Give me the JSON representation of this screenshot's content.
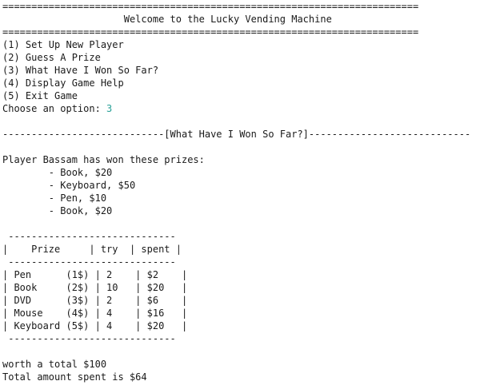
{
  "header": {
    "rule_top": "========================================================================",
    "title": "                     Welcome to the Lucky Vending Machine",
    "rule_bottom": "========================================================================"
  },
  "menu": {
    "items": [
      "(1) Set Up New Player",
      "(2) Guess A Prize",
      "(3) What Have I Won So Far?",
      "(4) Display Game Help",
      "(5) Exit Game"
    ],
    "prompt": "Choose an option: ",
    "input_value": "3"
  },
  "section": {
    "divider": "----------------------------[What Have I Won So Far?]----------------------------"
  },
  "winnings": {
    "heading": "Player Bassam has won these prizes:",
    "prizes": [
      "        - Book, $20",
      "        - Keyboard, $50",
      "        - Pen, $10",
      "        - Book, $20"
    ]
  },
  "table": {
    "rule": " -----------------------------",
    "header_row": "|    Prize     | try  | spent |",
    "rows": [
      "| Pen      (1$) | 2    | $2    |",
      "| Book     (2$) | 10   | $20   |",
      "| DVD      (3$) | 2    | $6    |",
      "| Mouse    (4$) | 4    | $16   |",
      "| Keyboard (5$) | 4    | $20   |"
    ]
  },
  "summary": {
    "worth": "worth a total $100",
    "spent": "Total amount spent is $64"
  },
  "colors": {
    "background": "#ffffff",
    "text": "#1a1a1a",
    "input_echo": "#2aa198"
  }
}
